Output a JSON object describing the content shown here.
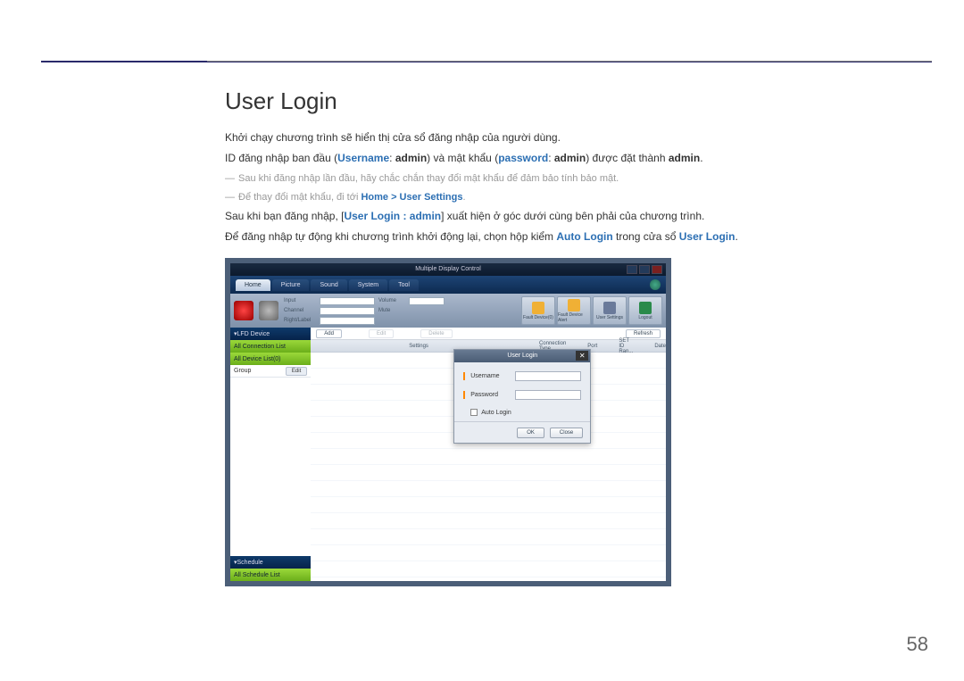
{
  "page": {
    "number": "58"
  },
  "doc": {
    "heading": "User Login",
    "p1": "Khởi chạy chương trình sẽ hiển thị cửa sổ đăng nhập của người dùng.",
    "p2a": "ID đăng nhập ban đầu (",
    "p2_user_label": "Username",
    "p2b": ": ",
    "p2_user_val": "admin",
    "p2c": ") và mật khẩu (",
    "p2_pass_label": "password",
    "p2d": ": ",
    "p2_pass_val": "admin",
    "p2e": ") được đặt thành ",
    "p2_admin": "admin",
    "p2f": ".",
    "note1": "Sau khi đăng nhập lần đầu, hãy chắc chắn thay đổi mật khẩu để đảm bảo tính bảo mật.",
    "note2a": "Để thay đổi mật khẩu, đi tới ",
    "note2b": "Home > User Settings",
    "note2c": ".",
    "p3a": "Sau khi bạn đăng nhập, [",
    "p3b": "User Login : admin",
    "p3c": "] xuất hiện ở góc dưới cùng bên phải của chương trình.",
    "p4a": "Để đăng nhập tự động khi chương trình khởi động lại, chọn hộp kiểm ",
    "p4b": "Auto Login",
    "p4c": " trong cửa sổ ",
    "p4d": "User Login",
    "p4e": "."
  },
  "app": {
    "title": "Multiple Display Control",
    "tabs": [
      "Home",
      "Picture",
      "Sound",
      "System",
      "Tool"
    ],
    "toolbar_form": {
      "input": "Input",
      "channel": "Channel",
      "rightlabel": "Right/Label",
      "volume": "Volume",
      "mute": "Mute"
    },
    "tb_icons": {
      "fault": "Fault Device(0)",
      "alert": "Fault Device Alert",
      "users": "User Settings",
      "logout": "Logout"
    },
    "sidebar": {
      "lfd": "LFD Device",
      "conn": "All Connection List",
      "devlist": "All Device List(0)",
      "group": "Group",
      "edit": "Edit",
      "schedule": "Schedule",
      "schedlist": "All Schedule List"
    },
    "main_btns": {
      "add": "Add",
      "edit": "Edit",
      "delete": "Delete",
      "refresh": "Refresh"
    },
    "headers": {
      "settings": "Settings",
      "conntype": "Connection Type",
      "port": "Port",
      "setid": "SET ID Ran...",
      "date": "Date"
    },
    "login": {
      "title": "User Login",
      "username": "Username",
      "password": "Password",
      "auto": "Auto Login",
      "ok": "OK",
      "close": "Close"
    }
  }
}
